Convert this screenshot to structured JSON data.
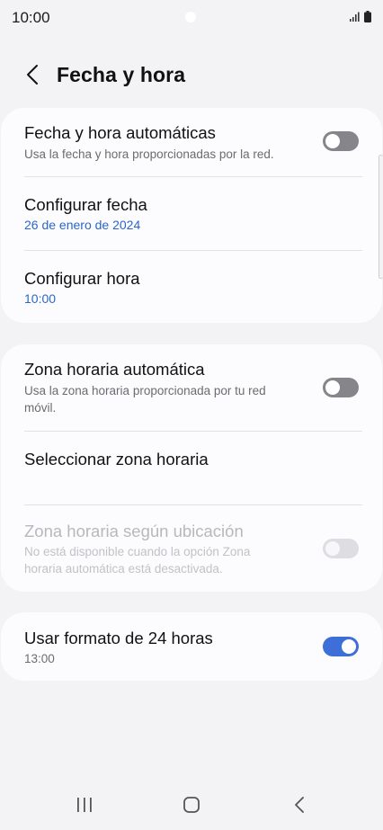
{
  "status_bar": {
    "time": "10:00"
  },
  "header": {
    "title": "Fecha y hora",
    "back_icon": "chevron-left-icon"
  },
  "card1": {
    "auto_datetime": {
      "title": "Fecha y hora automáticas",
      "subtitle": "Usa la fecha y hora proporcionadas por la red.",
      "toggle_on": false
    },
    "set_date": {
      "title": "Configurar fecha",
      "value": "26 de enero de 2024"
    },
    "set_time": {
      "title": "Configurar hora",
      "value": "10:00"
    }
  },
  "card2": {
    "auto_timezone": {
      "title": "Zona horaria automática",
      "subtitle": "Usa la zona horaria proporcionada por tu red móvil.",
      "toggle_on": false
    },
    "select_timezone": {
      "title": "Seleccionar zona horaria"
    },
    "location_timezone": {
      "title": "Zona horaria según ubicación",
      "subtitle": "No está disponible cuando la opción Zona horaria automática está desactivada.",
      "toggle_on": false,
      "enabled": false
    }
  },
  "card3": {
    "format_24h": {
      "title": "Usar formato de 24 horas",
      "value": "13:00",
      "toggle_on": true
    }
  },
  "colors": {
    "accent": "#3e6fd8",
    "value_text": "#2a66c8",
    "background": "#f3f3f6",
    "card": "#fcfcfe"
  },
  "nav_bar": {
    "recents_icon": "recents-icon",
    "home_icon": "home-icon",
    "back_icon": "back-icon"
  }
}
